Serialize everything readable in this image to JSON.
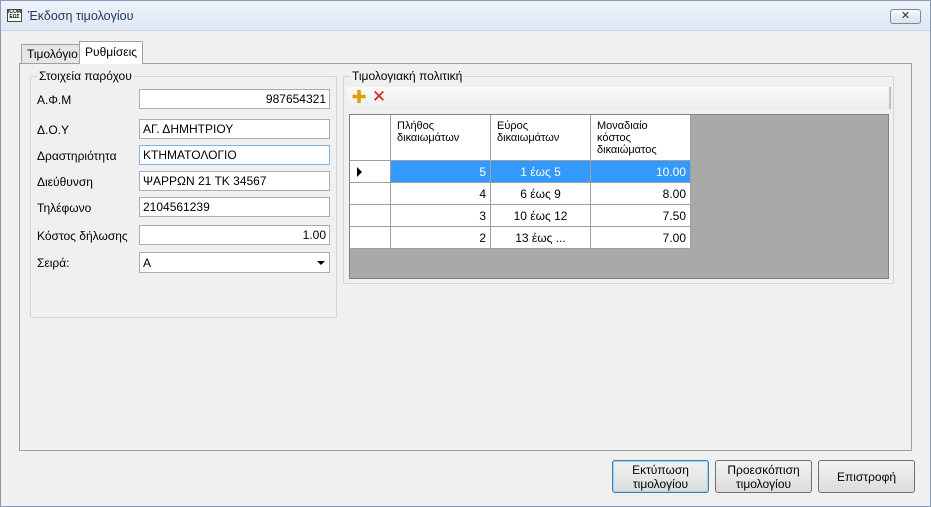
{
  "window": {
    "title": "Έκδοση τιμολογίου",
    "icon_text": "ICOMA ΕΩΣ",
    "close_glyph": "✕"
  },
  "tabs": [
    {
      "label": "Τιμολόγιο",
      "active": false
    },
    {
      "label": "Ρυθμίσεις",
      "active": true
    }
  ],
  "provider": {
    "legend": "Στοιχεία παρόχου",
    "fields": {
      "afm": {
        "label": "Α.Φ.Μ",
        "value": "987654321"
      },
      "doy": {
        "label": "Δ.Ο.Υ",
        "value": "ΑΓ. ΔΗΜΗΤΡΙΟΥ"
      },
      "activity": {
        "label": "Δραστηριότητα",
        "value": "ΚΤΗΜΑΤΟΛΟΓΙΟ"
      },
      "address": {
        "label": "Διεύθυνση",
        "value": "ΨΑΡΡΩΝ 21 ΤΚ 34567"
      },
      "phone": {
        "label": "Τηλέφωνο",
        "value": "2104561239"
      },
      "declaration_cost": {
        "label": "Κόστος δήλωσης",
        "value": "1.00"
      },
      "series": {
        "label": "Σειρά:",
        "value": "Α"
      }
    }
  },
  "pricing": {
    "legend": "Τιμολογιακή πολιτική",
    "add_glyph": "✚",
    "delete_glyph": "✕",
    "columns": [
      {
        "label": "Πλήθος δικαιωμάτων"
      },
      {
        "label": "Εύρος δικαιωμάτων"
      },
      {
        "label": "Μοναδιαίο κόστος δικαιώματος"
      }
    ],
    "rows": [
      {
        "count": "5",
        "range": "1 έως 5",
        "unit_cost": "10.00"
      },
      {
        "count": "4",
        "range": "6 έως 9",
        "unit_cost": "8.00"
      },
      {
        "count": "3",
        "range": "10 έως 12",
        "unit_cost": "7.50"
      },
      {
        "count": "2",
        "range": "13 έως ...",
        "unit_cost": "7.00"
      }
    ]
  },
  "buttons": {
    "print": "Εκτύπωση τιμολογίου",
    "preview": "Προεσκόπιση τιμολογίου",
    "back": "Επιστροφή"
  }
}
